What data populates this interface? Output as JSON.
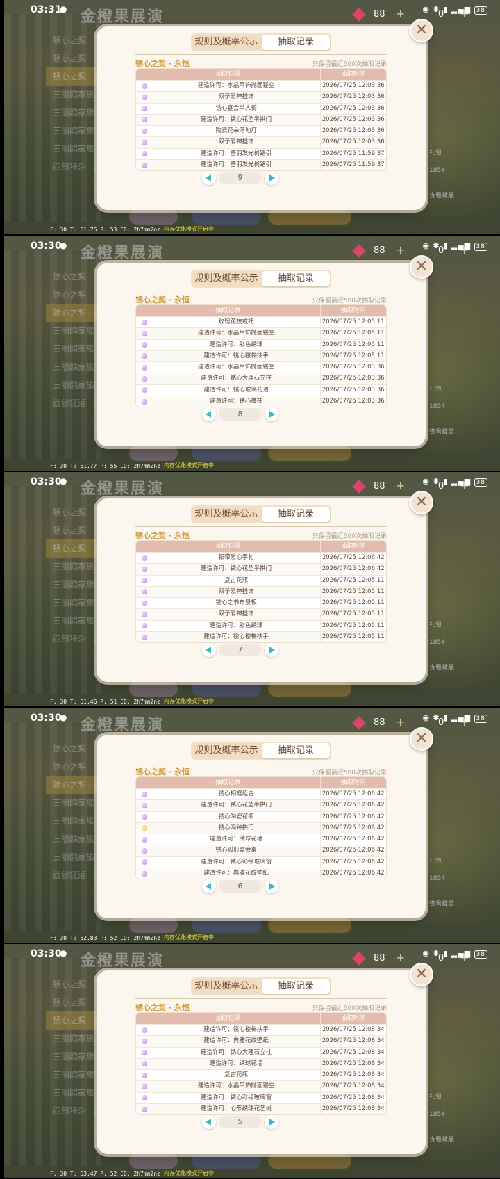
{
  "game": {
    "title": "金橙果展演",
    "gems": "88",
    "plus": "+",
    "currency2": "0"
  },
  "sidebar": [
    "锈心之契",
    "锈心之契",
    "锈心之契 · 永恒",
    "三丽鸥家族",
    "三丽鸥家族",
    "三丽鸥家族",
    "三丽鸥家族",
    "西部狂活 · 游戏"
  ],
  "right_labels": {
    "gift": "礼包",
    "count": "1854",
    "view": "查看藏品"
  },
  "modal": {
    "tab_rules": "规则及概率公示",
    "tab_records": "抽取记录",
    "banner": "锈心之契 · 永恒",
    "note": "只保留最近500次抽取记录",
    "col_record": "抽取记录",
    "col_time": "抽取时间",
    "close": "✕"
  },
  "shots": [
    {
      "time": "03:31",
      "debug": "F: 30  T: 61.76  P: 53  ID: 2h7mm2nz",
      "debug_r": "内存优化模式开启中",
      "page": "9",
      "rows": [
        {
          "name": "建造许可：水晶吊饰抛面镂空",
          "time": "2026/07/25 12:03:36",
          "gold": false
        },
        {
          "name": "双子爱神挂饰",
          "time": "2026/07/25 12:03:36",
          "gold": false
        },
        {
          "name": "锈心宴会单人椅",
          "time": "2026/07/25 12:03:36",
          "gold": false
        },
        {
          "name": "建造许可：锈心花坠半拱门",
          "time": "2026/07/25 12:03:36",
          "gold": false
        },
        {
          "name": "陶瓷花朵落地灯",
          "time": "2026/07/25 12:03:36",
          "gold": false
        },
        {
          "name": "双子爱神挂饰",
          "time": "2026/07/25 12:03:36",
          "gold": false
        },
        {
          "name": "建造许可：垂羽发光树路引",
          "time": "2026/07/25 11:59:37",
          "gold": false
        },
        {
          "name": "建造许可：垂羽发光树路引",
          "time": "2026/07/25 11:59:37",
          "gold": false
        }
      ]
    },
    {
      "time": "03:30",
      "debug": "F: 30  T: 61.77  P: 55  ID: 2h7mm2nz",
      "debug_r": "内存优化模式开启中",
      "page": "8",
      "rows": [
        {
          "name": "玫瑰花枝戒托",
          "time": "2026/07/25 12:05:11",
          "gold": false
        },
        {
          "name": "建造许可：水晶吊饰抛面镂空",
          "time": "2026/07/25 12:05:11",
          "gold": false
        },
        {
          "name": "建造许可：彩色绣球",
          "time": "2026/07/25 12:05:11",
          "gold": false
        },
        {
          "name": "建造许可：锈心楼梯扶手",
          "time": "2026/07/25 12:05:11",
          "gold": false
        },
        {
          "name": "建造许可：水晶吊饰抛面镂空",
          "time": "2026/07/25 12:03:36",
          "gold": false
        },
        {
          "name": "建造许可：锈心大理石立柱",
          "time": "2026/07/25 12:03:36",
          "gold": false
        },
        {
          "name": "建造许可：锈心玻璃花道",
          "time": "2026/07/25 12:03:36",
          "gold": false
        },
        {
          "name": "建造许可：锈心楼梯",
          "time": "2026/07/25 12:03:36",
          "gold": false
        }
      ]
    },
    {
      "time": "03:30",
      "debug": "F: 30  T: 61.46  P: 51  ID: 2h7mm2nz",
      "debug_r": "内存优化模式开启中",
      "page": "7",
      "rows": [
        {
          "name": "银带爱心手札",
          "time": "2026/07/25 12:06:42",
          "gold": false
        },
        {
          "name": "建造许可：锈心花坠半拱门",
          "time": "2026/07/25 12:06:42",
          "gold": false
        },
        {
          "name": "复古花瓶",
          "time": "2026/07/25 12:05:11",
          "gold": false
        },
        {
          "name": "双子爱神挂饰",
          "time": "2026/07/25 12:05:11",
          "gold": false
        },
        {
          "name": "锈心之书布景板",
          "time": "2026/07/25 12:05:11",
          "gold": false
        },
        {
          "name": "双子爱神挂饰",
          "time": "2026/07/25 12:05:11",
          "gold": false
        },
        {
          "name": "建造许可：彩色绣球",
          "time": "2026/07/25 12:05:11",
          "gold": false
        },
        {
          "name": "建造许可：锈心楼梯扶手",
          "time": "2026/07/25 12:05:11",
          "gold": false
        }
      ]
    },
    {
      "time": "03:30",
      "debug": "F: 30  T: 62.83  P: 52  ID: 2h7mm2nz",
      "debug_r": "内存优化模式开启中",
      "page": "6",
      "rows": [
        {
          "name": "锈心相框组合",
          "time": "2026/07/25 12:06:42",
          "gold": false
        },
        {
          "name": "建造许可：锈心花坠半拱门",
          "time": "2026/07/25 12:06:42",
          "gold": false
        },
        {
          "name": "锈心陶瓷花瓶",
          "time": "2026/07/25 12:06:42",
          "gold": false
        },
        {
          "name": "锈心鸣钟拱门",
          "time": "2026/07/25 12:06:42",
          "gold": true
        },
        {
          "name": "建造许可：绣球花墙",
          "time": "2026/07/25 12:06:42",
          "gold": false
        },
        {
          "name": "锈心弧形宴会桌",
          "time": "2026/07/25 12:06:42",
          "gold": false
        },
        {
          "name": "建造许可：锈心彩绘玻璃窗",
          "time": "2026/07/25 12:06:42",
          "gold": false
        },
        {
          "name": "建造许可：典雅花纹壁纸",
          "time": "2026/07/25 12:06:42",
          "gold": false
        }
      ]
    },
    {
      "time": "03:30",
      "debug": "F: 30  T: 63.47  P: 52  ID: 2h7mm2nz",
      "debug_r": "内存优化模式开启中",
      "page": "5",
      "rows": [
        {
          "name": "建造许可：锈心楼梯扶手",
          "time": "2026/07/25 12:08:34",
          "gold": false
        },
        {
          "name": "建造许可：典雅花纹壁纸",
          "time": "2026/07/25 12:08:34",
          "gold": false
        },
        {
          "name": "建造许可：锈心大理石立柱",
          "time": "2026/07/25 12:08:34",
          "gold": false
        },
        {
          "name": "建造许可：绣球花墙",
          "time": "2026/07/25 12:08:34",
          "gold": false
        },
        {
          "name": "复古花瓶",
          "time": "2026/07/25 12:08:34",
          "gold": false
        },
        {
          "name": "建造许可：水晶吊饰抛面镂空",
          "time": "2026/07/25 12:08:34",
          "gold": false
        },
        {
          "name": "建造许可：锈心彩绘玻璃窗",
          "time": "2026/07/25 12:08:34",
          "gold": false
        },
        {
          "name": "建造许可：心形绣球花艺树",
          "time": "2026/07/25 12:08:34",
          "gold": false
        }
      ]
    }
  ]
}
